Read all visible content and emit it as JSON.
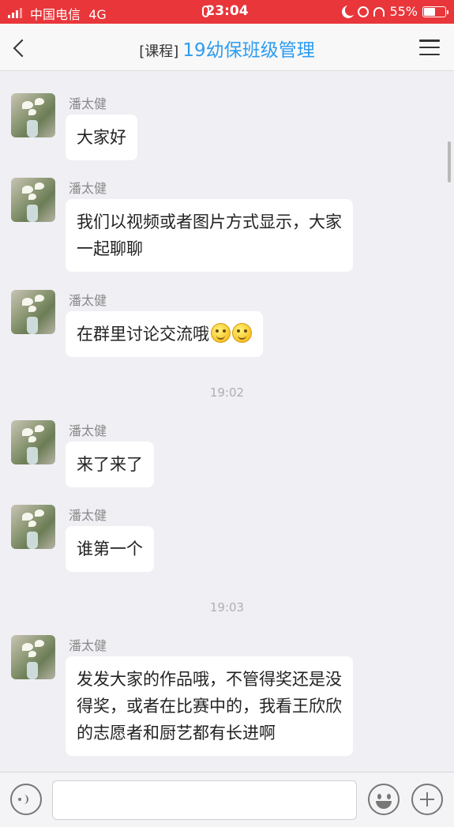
{
  "status_bar": {
    "carrier": "中国电信",
    "network": "4G",
    "time": "23:04",
    "battery": "55%"
  },
  "header": {
    "tag": "[课程]",
    "title": "19幼保班级管理"
  },
  "messages": [
    {
      "sender": "潘太健",
      "text": "大家好"
    },
    {
      "sender": "潘太健",
      "lines": [
        "我们以视频或者图片方式显示，大家",
        "一起聊聊"
      ]
    },
    {
      "sender": "潘太健",
      "text": "在群里讨论交流哦"
    },
    {
      "sender": "潘太健",
      "text": "来了来了"
    },
    {
      "sender": "潘太健",
      "text": "谁第一个"
    },
    {
      "sender": "潘太健",
      "lines": [
        "发发大家的作品哦，不管得奖还是没",
        "得奖，或者在比赛中的，我看王欣欣",
        "的志愿者和厨艺都有长进啊"
      ]
    }
  ],
  "timestamps": [
    "19:02",
    "19:03"
  ],
  "colors": {
    "accent": "#2d9cf0",
    "status_bar": "#e8363a",
    "background": "#efeff4"
  }
}
